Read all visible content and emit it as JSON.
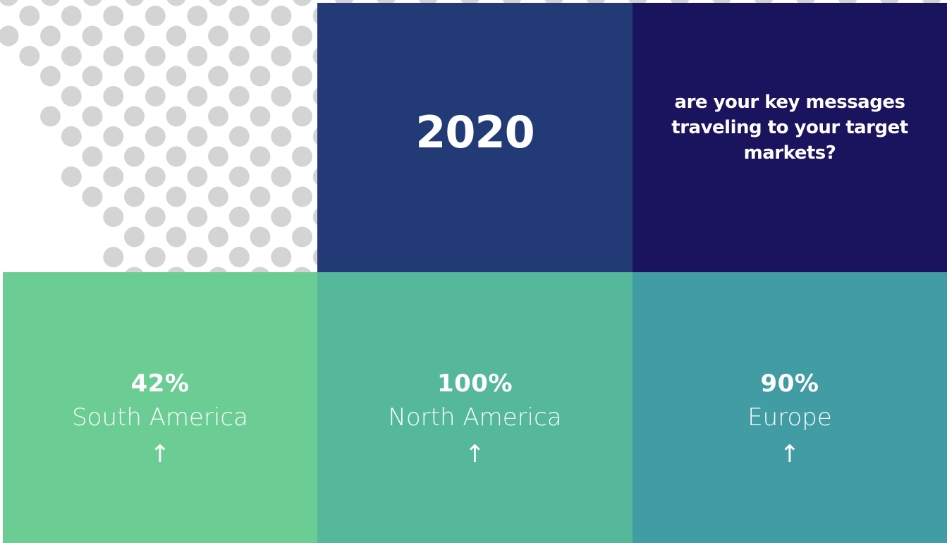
{
  "header": {
    "year": "2020",
    "question": "are your key messages traveling to your target markets?"
  },
  "stats": [
    {
      "value": "42%",
      "region": "South America",
      "arrow": "↑"
    },
    {
      "value": "100%",
      "region": "North America",
      "arrow": "↑"
    },
    {
      "value": "90%",
      "region": "Europe",
      "arrow": "↑"
    }
  ],
  "colors": {
    "dots": "#d4d4d4",
    "year_tile": "#223a75",
    "question_tile": "#1a145e",
    "south_america_tile": "#6bcd93",
    "north_america_tile": "#55b89a",
    "europe_tile": "#419ca3"
  }
}
